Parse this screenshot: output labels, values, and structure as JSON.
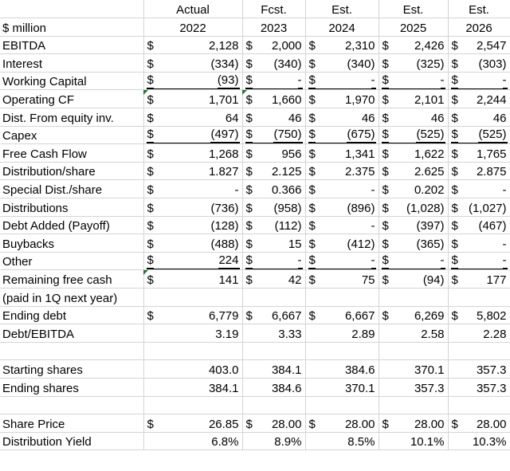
{
  "header": {
    "row1": [
      "",
      "Actual",
      "Fcst.",
      "Est.",
      "Est.",
      "Est."
    ],
    "row2": [
      "$ million",
      "2022",
      "2023",
      "2024",
      "2025",
      "2026"
    ]
  },
  "rows": [
    {
      "label": "EBITDA",
      "cells": [
        [
          "$",
          "2,128"
        ],
        [
          "$",
          "2,000"
        ],
        [
          "$",
          "2,310"
        ],
        [
          "$",
          "2,426"
        ],
        [
          "$",
          "2,547"
        ]
      ]
    },
    {
      "label": "Interest",
      "cells": [
        [
          "$",
          "(334)"
        ],
        [
          "$",
          "(340)"
        ],
        [
          "$",
          "(340)"
        ],
        [
          "$",
          "(325)"
        ],
        [
          "$",
          "(303)"
        ]
      ]
    },
    {
      "label": "Working Capital",
      "underline": true,
      "cells": [
        [
          "$",
          "(93)"
        ],
        [
          "$",
          "-"
        ],
        [
          "$",
          "-"
        ],
        [
          "$",
          "-"
        ],
        [
          "$",
          "-"
        ]
      ]
    },
    {
      "label": "Operating CF",
      "cells": [
        [
          "$",
          "1,701"
        ],
        [
          "$",
          "1,660"
        ],
        [
          "$",
          "1,970"
        ],
        [
          "$",
          "2,101"
        ],
        [
          "$",
          "2,244"
        ]
      ]
    },
    {
      "label": "Dist. From equity inv.",
      "cells": [
        [
          "$",
          "64"
        ],
        [
          "$",
          "46"
        ],
        [
          "$",
          "46"
        ],
        [
          "$",
          "46"
        ],
        [
          "$",
          "46"
        ]
      ]
    },
    {
      "label": "Capex",
      "underline": true,
      "cells": [
        [
          "$",
          "(497)"
        ],
        [
          "$",
          "(750)"
        ],
        [
          "$",
          "(675)"
        ],
        [
          "$",
          "(525)"
        ],
        [
          "$",
          "(525)"
        ]
      ]
    },
    {
      "label": "Free Cash Flow",
      "cells": [
        [
          "$",
          "1,268"
        ],
        [
          "$",
          "956"
        ],
        [
          "$",
          "1,341"
        ],
        [
          "$",
          "1,622"
        ],
        [
          "$",
          "1,765"
        ]
      ]
    },
    {
      "label": "Distribution/share",
      "cells": [
        [
          "$",
          "1.827"
        ],
        [
          "$",
          "2.125"
        ],
        [
          "$",
          "2.375"
        ],
        [
          "$",
          "2.625"
        ],
        [
          "$",
          "2.875"
        ]
      ]
    },
    {
      "label": "Special Dist./share",
      "cells": [
        [
          "$",
          "-"
        ],
        [
          "$",
          "0.366"
        ],
        [
          "$",
          "-"
        ],
        [
          "$",
          "0.202"
        ],
        [
          "$",
          "-"
        ]
      ]
    },
    {
      "label": "Distributions",
      "cells": [
        [
          "$",
          "(736)"
        ],
        [
          "$",
          "(958)"
        ],
        [
          "$",
          "(896)"
        ],
        [
          "$",
          "(1,028)"
        ],
        [
          "$",
          "(1,027)"
        ]
      ]
    },
    {
      "label": "Debt Added (Payoff)",
      "cells": [
        [
          "$",
          "(128)"
        ],
        [
          "$",
          "(112)"
        ],
        [
          "$",
          "-"
        ],
        [
          "$",
          "(397)"
        ],
        [
          "$",
          "(467)"
        ]
      ]
    },
    {
      "label": "Buybacks",
      "cells": [
        [
          "$",
          "(488)"
        ],
        [
          "$",
          "15"
        ],
        [
          "$",
          "(412)"
        ],
        [
          "$",
          "(365)"
        ],
        [
          "$",
          "-"
        ]
      ]
    },
    {
      "label": "Other",
      "underline": true,
      "cells": [
        [
          "$",
          "224"
        ],
        [
          "$",
          "-"
        ],
        [
          "$",
          "-"
        ],
        [
          "$",
          "-"
        ],
        [
          "$",
          "-"
        ]
      ]
    },
    {
      "label": "Remaining free cash",
      "cells": [
        [
          "$",
          "141"
        ],
        [
          "$",
          "42"
        ],
        [
          "$",
          "75"
        ],
        [
          "$",
          "(94)"
        ],
        [
          "$",
          "177"
        ]
      ]
    },
    {
      "label": "(paid in 1Q next year)",
      "cells": [
        [
          "",
          ""
        ],
        [
          "",
          ""
        ],
        [
          "",
          ""
        ],
        [
          "",
          ""
        ],
        [
          "",
          ""
        ]
      ]
    },
    {
      "label": "Ending debt",
      "cells": [
        [
          "$",
          "6,779"
        ],
        [
          "$",
          "6,667"
        ],
        [
          "$",
          "6,667"
        ],
        [
          "$",
          "6,269"
        ],
        [
          "$",
          "5,802"
        ]
      ]
    },
    {
      "label": "Debt/EBITDA",
      "cells": [
        [
          "",
          "3.19"
        ],
        [
          "",
          "3.33"
        ],
        [
          "",
          "2.89"
        ],
        [
          "",
          "2.58"
        ],
        [
          "",
          "2.28"
        ]
      ]
    },
    {
      "label": "",
      "cells": [
        [
          "",
          ""
        ],
        [
          "",
          ""
        ],
        [
          "",
          ""
        ],
        [
          "",
          ""
        ],
        [
          "",
          ""
        ]
      ]
    },
    {
      "label": "Starting shares",
      "cells": [
        [
          "",
          "403.0"
        ],
        [
          "",
          "384.1"
        ],
        [
          "",
          "384.6"
        ],
        [
          "",
          "370.1"
        ],
        [
          "",
          "357.3"
        ]
      ]
    },
    {
      "label": "Ending shares",
      "cells": [
        [
          "",
          "384.1"
        ],
        [
          "",
          "384.6"
        ],
        [
          "",
          "370.1"
        ],
        [
          "",
          "357.3"
        ],
        [
          "",
          "357.3"
        ]
      ]
    },
    {
      "label": "",
      "cells": [
        [
          "",
          ""
        ],
        [
          "",
          ""
        ],
        [
          "",
          ""
        ],
        [
          "",
          ""
        ],
        [
          "",
          ""
        ]
      ]
    },
    {
      "label": "Share Price",
      "cells": [
        [
          "$",
          "26.85"
        ],
        [
          "$",
          "28.00"
        ],
        [
          "$",
          "28.00"
        ],
        [
          "$",
          "28.00"
        ],
        [
          "$",
          "28.00"
        ]
      ]
    },
    {
      "label": "Distribution Yield",
      "cells": [
        [
          "",
          "6.8%"
        ],
        [
          "",
          "8.9%"
        ],
        [
          "",
          "8.5%"
        ],
        [
          "",
          "10.1%"
        ],
        [
          "",
          "10.3%"
        ]
      ]
    }
  ],
  "flags": [
    {
      "row": 3,
      "col": 1
    },
    {
      "row": 3,
      "col": 2
    },
    {
      "row": 13,
      "col": 1
    }
  ],
  "colors": {
    "gridline": "#d4d4d4",
    "error_flag": "#1e7b34"
  }
}
